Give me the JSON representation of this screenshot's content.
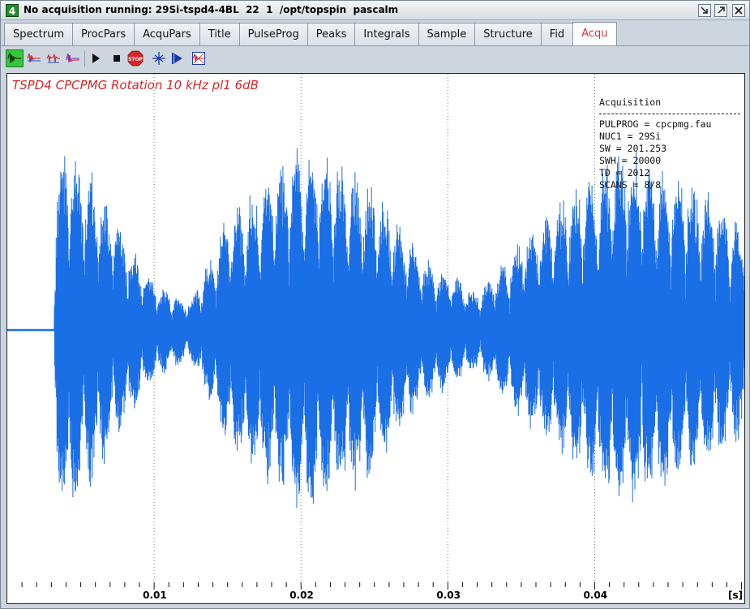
{
  "window": {
    "number": "4",
    "title": "No acquisition running: 29Si-tspd4-4BL  22  1  /opt/topspin  pascalm"
  },
  "tabs": [
    {
      "label": "Spectrum"
    },
    {
      "label": "ProcPars"
    },
    {
      "label": "AcquPars"
    },
    {
      "label": "Title"
    },
    {
      "label": "PulseProg"
    },
    {
      "label": "Peaks"
    },
    {
      "label": "Integrals"
    },
    {
      "label": "Sample"
    },
    {
      "label": "Structure"
    },
    {
      "label": "Fid"
    },
    {
      "label": "Acqu"
    }
  ],
  "active_tab": "Acqu",
  "toolbar": {
    "icons": [
      "fid-view-icon",
      "fid-view-alt-icon",
      "fid-multi-icon",
      "fid-overlay-icon",
      "play-icon",
      "stop-square-icon",
      "stop-sign-icon",
      "gs-adjust-icon",
      "lock-icon",
      "acq-params-icon"
    ]
  },
  "plot": {
    "title": "TSPD4 CPCPMG Rotation 10 kHz pl1 6dB",
    "acquisition_header": "Acquisition",
    "params": [
      "PULPROG = cpcpmg.fau",
      "NUC1 = 29Si",
      "SW = 201.253",
      "SWH = 20000",
      "TD = 2012",
      "SCANS = 8/8"
    ],
    "trace_color": "#1a6ee6",
    "title_color": "#d42a2a"
  },
  "chart_data": {
    "type": "line",
    "title": "TSPD4 CPCPMG Rotation 10 kHz pl1 6dB",
    "xlabel": "[s]",
    "ylabel": "",
    "xlim": [
      0.0,
      0.0503
    ],
    "x_ticks": [
      "0.01",
      "0.02",
      "0.03",
      "0.04"
    ],
    "x_ticks_values": [
      0.01,
      0.02,
      0.03,
      0.04
    ],
    "x_unit_label": "[s]",
    "grid": "vertical dotted at major ticks",
    "series": [
      {
        "envelope_max_abs": [
          {
            "t": 0.0,
            "a": 0.0
          },
          {
            "t": 0.0031,
            "a": 0.02
          },
          {
            "t": 0.0034,
            "a": 0.8
          },
          {
            "t": 0.004,
            "a": 1.0
          },
          {
            "t": 0.006,
            "a": 0.75
          },
          {
            "t": 0.008,
            "a": 0.5
          },
          {
            "t": 0.01,
            "a": 0.25
          },
          {
            "t": 0.0125,
            "a": 0.15
          },
          {
            "t": 0.015,
            "a": 0.6
          },
          {
            "t": 0.02,
            "a": 0.95
          },
          {
            "t": 0.025,
            "a": 0.75
          },
          {
            "t": 0.028,
            "a": 0.4
          },
          {
            "t": 0.032,
            "a": 0.2
          },
          {
            "t": 0.036,
            "a": 0.55
          },
          {
            "t": 0.042,
            "a": 0.95
          },
          {
            "t": 0.048,
            "a": 0.7
          },
          {
            "t": 0.0503,
            "a": 0.5
          }
        ],
        "echo_period_s": 0.001
      }
    ]
  }
}
